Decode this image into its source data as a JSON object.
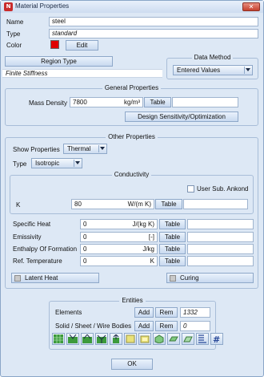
{
  "window": {
    "title": "Material Properties",
    "close_glyph": "✕"
  },
  "header": {
    "name_label": "Name",
    "name_value": "steel",
    "type_label": "Type",
    "type_value": "standard",
    "color_label": "Color",
    "color_value": "#e00000",
    "edit_label": "Edit"
  },
  "region": {
    "button_label": "Region Type",
    "value": "Finite Stiffness"
  },
  "data_method": {
    "title": "Data Method",
    "selected": "Entered Values"
  },
  "general": {
    "title": "General Properties",
    "density_label": "Mass Density",
    "density_value": "7800",
    "density_unit": "kg/m³",
    "table_label": "Table",
    "sensitivity_label": "Design Sensitivity/Optimization"
  },
  "other": {
    "title": "Other Properties",
    "show_label": "Show Properties",
    "show_selected": "Thermal",
    "type_label": "Type",
    "type_selected": "Isotropic"
  },
  "conductivity": {
    "title": "Conductivity",
    "user_sub_label": "User Sub. Ankond",
    "k_label": "K",
    "k_value": "80",
    "k_unit": "W/(m K)",
    "table_label": "Table"
  },
  "properties": [
    {
      "label": "Specific Heat",
      "value": "0",
      "unit": "J/(kg K)",
      "table": "Table"
    },
    {
      "label": "Emissivity",
      "value": "0",
      "unit": "[-]",
      "table": "Table"
    },
    {
      "label": "Enthalpy Of Formation",
      "value": "0",
      "unit": "J/kg",
      "table": "Table"
    },
    {
      "label": "Ref. Temperature",
      "value": "0",
      "unit": "K",
      "table": "Table"
    }
  ],
  "toggles": {
    "latent_heat": "Latent Heat",
    "curing": "Curing"
  },
  "entities": {
    "title": "Entities",
    "elements_label": "Elements",
    "elements_count": "1332",
    "bodies_label": "Solid / Sheet / Wire Bodies",
    "bodies_count": "0",
    "add_label": "Add",
    "rem_label": "Rem",
    "tools": [
      "select-elements-icon",
      "add-elements-icon",
      "remove-elements-icon",
      "check-elements-icon",
      "export-elements-icon",
      "select-bodies-icon",
      "add-bodies-icon",
      "solid-body-icon",
      "sheet-body-icon",
      "wire-body-icon",
      "list-icon",
      "count-icon"
    ]
  },
  "footer": {
    "ok_label": "OK"
  }
}
